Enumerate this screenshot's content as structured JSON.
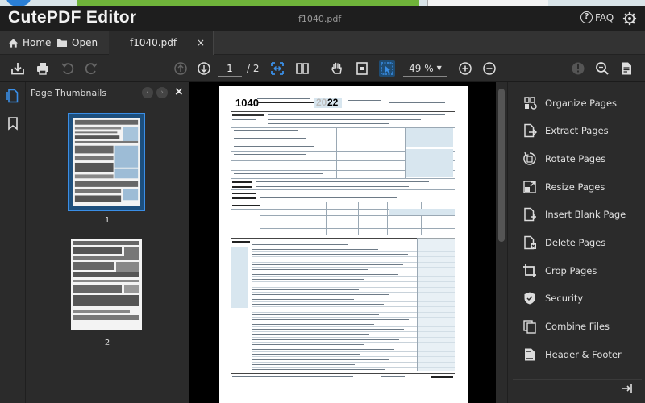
{
  "app": {
    "title": "CutePDF Editor",
    "document_title": "f1040.pdf",
    "faq_label": "FAQ"
  },
  "tabs": [
    {
      "label": "Home",
      "icon": "home-icon"
    },
    {
      "label": "Open",
      "icon": "folder-icon"
    },
    {
      "label": "f1040.pdf",
      "icon": "",
      "close": "×"
    }
  ],
  "toolbar": {
    "current_page": "1",
    "total_pages": "/ 2",
    "zoom": "49 %",
    "icons": [
      "download-icon",
      "print-icon",
      "undo-icon",
      "redo-icon",
      "previous-page-icon",
      "next-page-icon",
      "fit-width-icon",
      "two-page-view-icon",
      "hand-tool-icon",
      "fit-page-icon",
      "select-tool-icon",
      "zoom-in-icon",
      "zoom-out-icon",
      "info-icon",
      "search-icon",
      "document-properties-icon"
    ]
  },
  "thumbnails": {
    "title": "Page Thumbnails",
    "close": "×",
    "pages": [
      {
        "label": "1",
        "selected": true
      },
      {
        "label": "2",
        "selected": false
      }
    ]
  },
  "document": {
    "form_number": "1040",
    "year_prefix": "20",
    "year_suffix": "22"
  },
  "tools": [
    {
      "label": "Organize Pages",
      "icon": "organize-pages-icon"
    },
    {
      "label": "Extract Pages",
      "icon": "extract-pages-icon"
    },
    {
      "label": "Rotate Pages",
      "icon": "rotate-pages-icon"
    },
    {
      "label": "Resize Pages",
      "icon": "resize-pages-icon"
    },
    {
      "label": "Insert Blank Page",
      "icon": "insert-blank-page-icon"
    },
    {
      "label": "Delete Pages",
      "icon": "delete-pages-icon"
    },
    {
      "label": "Crop Pages",
      "icon": "crop-pages-icon"
    },
    {
      "label": "Security",
      "icon": "security-icon"
    },
    {
      "label": "Combine Files",
      "icon": "combine-files-icon"
    },
    {
      "label": "Header & Footer",
      "icon": "header-footer-icon"
    }
  ],
  "colors": {
    "accent": "#3a8ee6",
    "form_shade": "#d8e6ef",
    "background": "#2b2b2b"
  }
}
